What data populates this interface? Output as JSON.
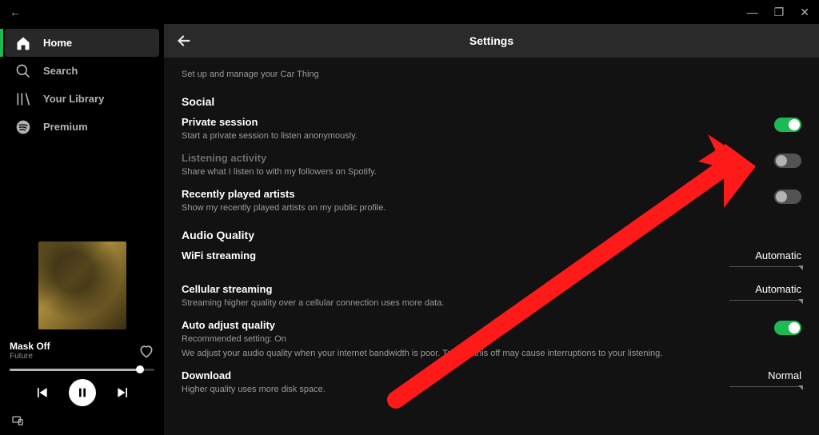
{
  "window": {
    "back_icon": "←",
    "min_icon": "—",
    "restore_icon": "❐",
    "close_icon": "✕"
  },
  "sidebar": {
    "items": [
      {
        "label": "Home"
      },
      {
        "label": "Search"
      },
      {
        "label": "Your Library"
      },
      {
        "label": "Premium"
      }
    ]
  },
  "now_playing": {
    "title": "Mask Off",
    "artist": "Future"
  },
  "settings": {
    "header": "Settings",
    "car_thing_desc": "Set up and manage your Car Thing",
    "social": {
      "title": "Social",
      "private_session": {
        "t": "Private session",
        "d": "Start a private session to listen anonymously.",
        "on": true
      },
      "listening_activity": {
        "t": "Listening activity",
        "d": "Share what I listen to with my followers on Spotify.",
        "on": false
      },
      "recently_played_artists": {
        "t": "Recently played artists",
        "d": "Show my recently played artists on my public profile.",
        "on": false
      }
    },
    "audio": {
      "title": "Audio Quality",
      "wifi": {
        "t": "WiFi streaming",
        "value": "Automatic"
      },
      "cellular": {
        "t": "Cellular streaming",
        "d": "Streaming higher quality over a cellular connection uses more data.",
        "value": "Automatic"
      },
      "auto_adjust": {
        "t": "Auto adjust quality",
        "d": "Recommended setting: On",
        "note": "We adjust your audio quality when your internet bandwidth is poor. Turning this off may cause interruptions to your listening.",
        "on": true
      },
      "download": {
        "t": "Download",
        "d": "Higher quality uses more disk space.",
        "value": "Normal"
      }
    }
  }
}
